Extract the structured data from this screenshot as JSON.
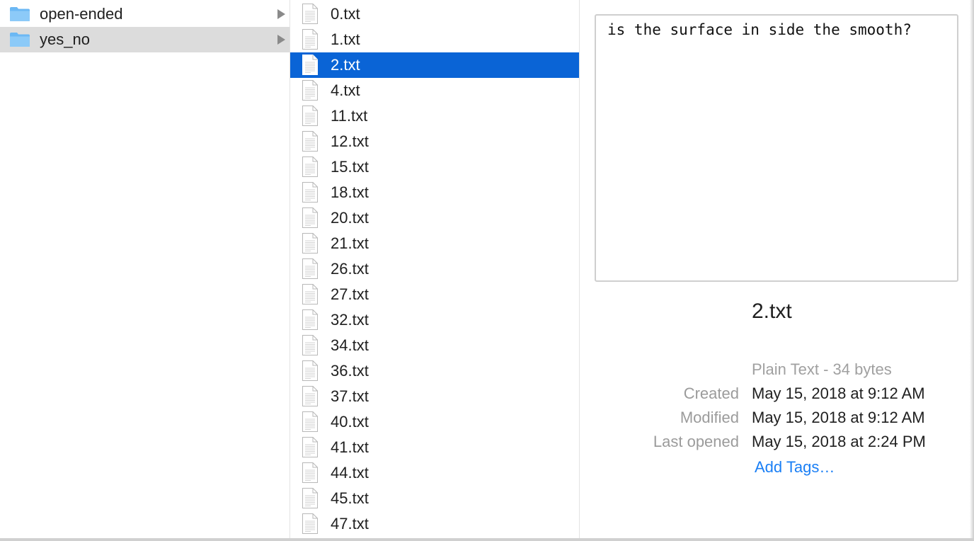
{
  "colors": {
    "selection_blue": "#0a64d6",
    "folder_blue": "#6cb8f4",
    "link_blue": "#1a7ff5",
    "label_gray": "#9b9b9b"
  },
  "folders": [
    {
      "name": "open-ended",
      "icon": "folder-icon",
      "selected": false,
      "has_children": true
    },
    {
      "name": "yes_no",
      "icon": "folder-icon",
      "selected": true,
      "has_children": true
    }
  ],
  "files": [
    {
      "name": "0.txt",
      "icon": "text-file-icon",
      "selected": false
    },
    {
      "name": "1.txt",
      "icon": "text-file-icon",
      "selected": false
    },
    {
      "name": "2.txt",
      "icon": "text-file-icon",
      "selected": true
    },
    {
      "name": "4.txt",
      "icon": "text-file-icon",
      "selected": false
    },
    {
      "name": "11.txt",
      "icon": "text-file-icon",
      "selected": false
    },
    {
      "name": "12.txt",
      "icon": "text-file-icon",
      "selected": false
    },
    {
      "name": "15.txt",
      "icon": "text-file-icon",
      "selected": false
    },
    {
      "name": "18.txt",
      "icon": "text-file-icon",
      "selected": false
    },
    {
      "name": "20.txt",
      "icon": "text-file-icon",
      "selected": false
    },
    {
      "name": "21.txt",
      "icon": "text-file-icon",
      "selected": false
    },
    {
      "name": "26.txt",
      "icon": "text-file-icon",
      "selected": false
    },
    {
      "name": "27.txt",
      "icon": "text-file-icon",
      "selected": false
    },
    {
      "name": "32.txt",
      "icon": "text-file-icon",
      "selected": false
    },
    {
      "name": "34.txt",
      "icon": "text-file-icon",
      "selected": false
    },
    {
      "name": "36.txt",
      "icon": "text-file-icon",
      "selected": false
    },
    {
      "name": "37.txt",
      "icon": "text-file-icon",
      "selected": false
    },
    {
      "name": "40.txt",
      "icon": "text-file-icon",
      "selected": false
    },
    {
      "name": "41.txt",
      "icon": "text-file-icon",
      "selected": false
    },
    {
      "name": "44.txt",
      "icon": "text-file-icon",
      "selected": false
    },
    {
      "name": "45.txt",
      "icon": "text-file-icon",
      "selected": false
    },
    {
      "name": "47.txt",
      "icon": "text-file-icon",
      "selected": false
    }
  ],
  "preview": {
    "content": "is the surface in side the smooth?",
    "title": "2.txt",
    "kind": "Plain Text - 34 bytes",
    "meta": [
      {
        "label": "Created",
        "value": "May 15, 2018 at 9:12 AM"
      },
      {
        "label": "Modified",
        "value": "May 15, 2018 at 9:12 AM"
      },
      {
        "label": "Last opened",
        "value": "May 15, 2018 at 2:24 PM"
      }
    ],
    "add_tags": "Add Tags…"
  }
}
